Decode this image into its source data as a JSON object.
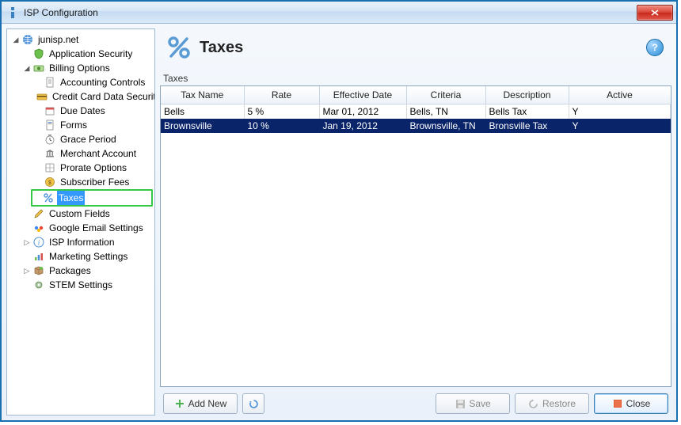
{
  "window": {
    "title": "ISP Configuration"
  },
  "tree": {
    "root": "junisp.net",
    "app_sec": "Application Security",
    "billing": "Billing Options",
    "billing_children": {
      "acct": "Accounting Controls",
      "cc": "Credit Card Data Security",
      "due": "Due Dates",
      "forms": "Forms",
      "grace": "Grace Period",
      "merchant": "Merchant Account",
      "prorate": "Prorate Options",
      "subfees": "Subscriber Fees",
      "taxes": "Taxes"
    },
    "custom": "Custom Fields",
    "google": "Google Email Settings",
    "isp_info": "ISP Information",
    "marketing": "Marketing Settings",
    "packages": "Packages",
    "stem": "STEM Settings"
  },
  "header": {
    "title": "Taxes",
    "section_label": "Taxes"
  },
  "grid": {
    "columns": {
      "name": "Tax Name",
      "rate": "Rate",
      "date": "Effective Date",
      "criteria": "Criteria",
      "desc": "Description",
      "active": "Active"
    },
    "rows": [
      {
        "name": "Bells",
        "rate": "5 %",
        "date": "Mar 01, 2012",
        "criteria": "Bells, TN",
        "desc": "Bells Tax",
        "active": "Y"
      },
      {
        "name": "Brownsville",
        "rate": "10 %",
        "date": "Jan 19, 2012",
        "criteria": "Brownsville, TN",
        "desc": "Bronsville Tax",
        "active": "Y"
      }
    ]
  },
  "buttons": {
    "add_new": "Add New",
    "save": "Save",
    "restore": "Restore",
    "close": "Close"
  },
  "help_glyph": "?"
}
